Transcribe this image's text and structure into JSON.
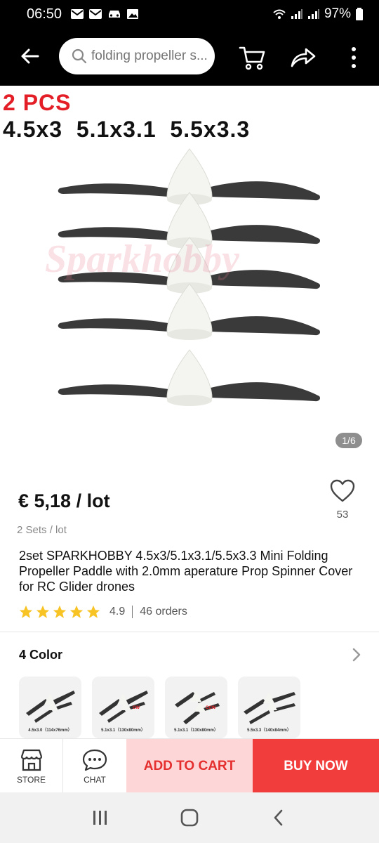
{
  "status_bar": {
    "time": "06:50",
    "battery": "97%",
    "left_icons": [
      "mail-icon",
      "mail-icon",
      "car-icon",
      "image-icon"
    ],
    "right_icons": [
      "wifi-icon",
      "signal-icon",
      "signal-icon",
      "battery-icon"
    ]
  },
  "app_bar": {
    "search_placeholder": "folding propeller s...",
    "icons": [
      "back-arrow-icon",
      "search-icon",
      "cart-icon",
      "share-icon",
      "more-vertical-icon"
    ]
  },
  "hero": {
    "promo_title": "2 PCS",
    "promo_sizes": "4.5x3  5.1x3.1  5.5x3.3",
    "watermark": "Sparkhobby",
    "image_counter": "1/6"
  },
  "product": {
    "price": "€ 5,18 / lot",
    "wishlist_count": "53",
    "lot_info": "2 Sets / lot",
    "title": "2set SPARKHOBBY 4.5x3/5.1x3.1/5.5x3.3 Mini Folding Propeller Paddle with 2.0mm aperature Prop Spinner Cover for RC Glider drones",
    "rating": "4.9",
    "orders": "46 orders",
    "star_count": 5
  },
  "colors": {
    "heading": "4 Color",
    "options": [
      {
        "label": "4.5x3.0（114x76mm）",
        "tag": ""
      },
      {
        "label": "5.1x3.1（130x80mm）",
        "tag": "CW"
      },
      {
        "label": "5.1x3.1（130x80mm）",
        "tag": "CCW"
      },
      {
        "label": "5.5x3.3（140x84mm）",
        "tag": ""
      }
    ]
  },
  "bottom_bar": {
    "store": "STORE",
    "chat": "CHAT",
    "add_to_cart": "ADD TO CART",
    "buy_now": "BUY NOW"
  },
  "theme": {
    "accent": "#f23d3d",
    "accent_light": "#fdd7d7",
    "star": "#f7c325"
  }
}
